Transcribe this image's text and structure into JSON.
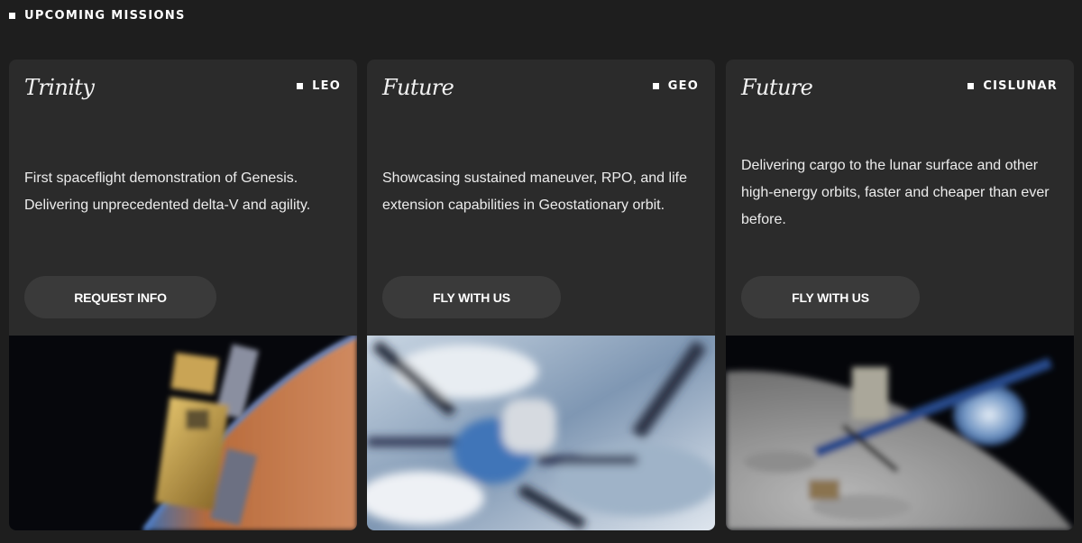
{
  "section": {
    "label": "UPCOMING MISSIONS"
  },
  "missions": [
    {
      "title": "Trinity",
      "orbit": "LEO",
      "description": "First spaceflight demonstration of Genesis. Delivering unprecedented delta-V and agility.",
      "button_label": "REQUEST INFO"
    },
    {
      "title": "Future",
      "orbit": "GEO",
      "description": "Showcasing sustained maneuver, RPO, and life extension capabilities in Geostationary orbit.",
      "button_label": "FLY WITH US"
    },
    {
      "title": "Future",
      "orbit": "CISLUNAR",
      "description": "Delivering cargo to the lunar surface and other high-energy orbits, faster and cheaper than ever before.",
      "button_label": "FLY WITH US"
    }
  ],
  "colors": {
    "page_background": "#1e1e1e",
    "card_background": "#2b2b2b",
    "button_background": "#3a3a3a",
    "text": "#ffffff"
  }
}
